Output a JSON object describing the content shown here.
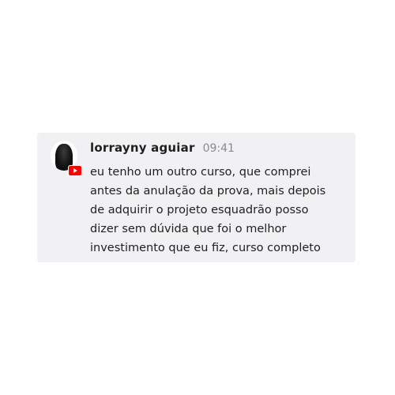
{
  "comment": {
    "author": "lorrayny aguiar",
    "time": "09:41",
    "text": "eu tenho um outro curso, que comprei\nantes da anulação da prova, mais depois\nde adquirir o projeto esquadrão posso\ndizer sem dúvida que foi o melhor\ninvestimento que eu fiz, curso completo",
    "badge_icon": "youtube-icon",
    "badge_color": "#ff0000",
    "card_background": "#f1f1f3"
  }
}
